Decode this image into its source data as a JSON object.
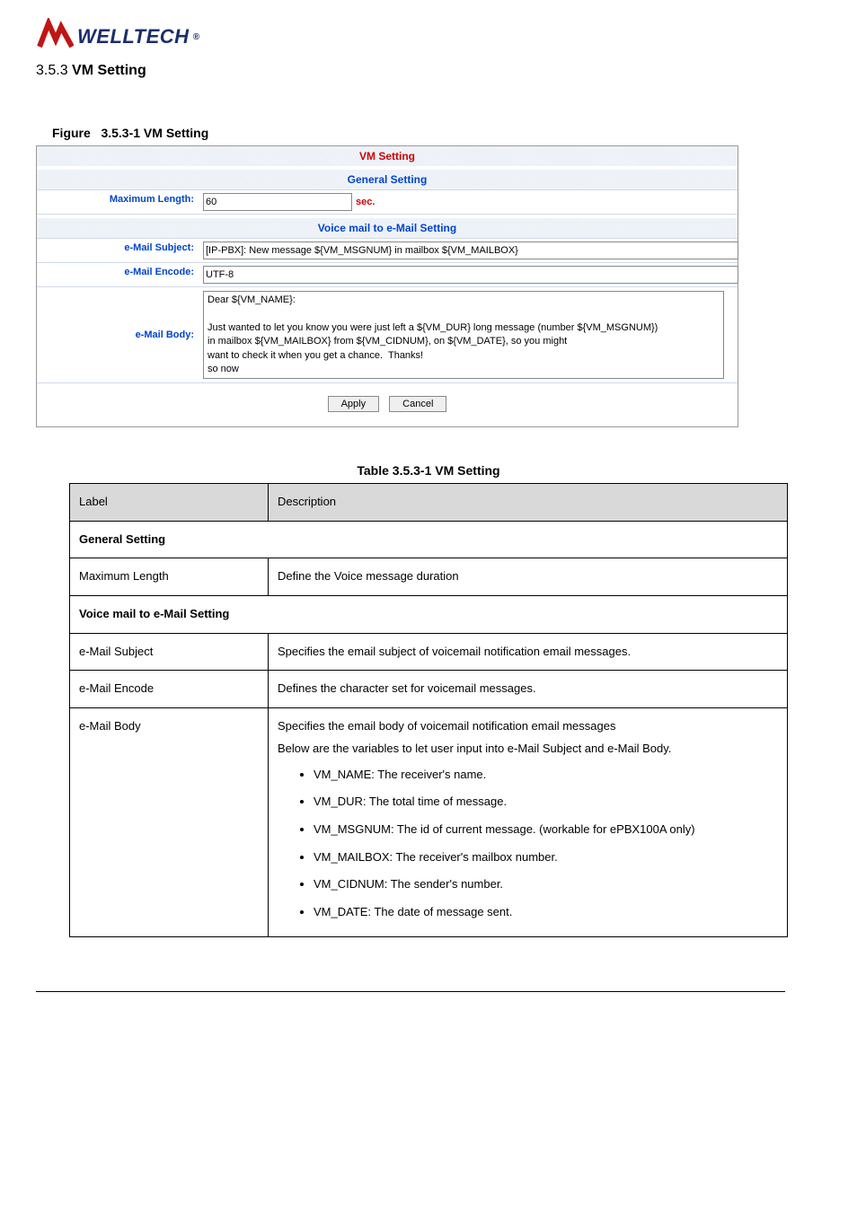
{
  "logo_text": "WELLTECH",
  "section_number": "3.5.3",
  "section_title": "VM Setting",
  "figure_caption_prefix": "Figure",
  "figure_caption": "3.5.3-1 VM Setting",
  "shot": {
    "title": "VM Setting",
    "general_heading": "General Setting",
    "max_length_label": "Maximum Length:",
    "max_length_value": "60",
    "sec_text": "sec.",
    "voice_heading": "Voice mail to e-Mail Setting",
    "subject_label": "e-Mail Subject:",
    "subject_value": "[IP-PBX]: New message ${VM_MSGNUM} in mailbox ${VM_MAILBOX}",
    "encode_label": "e-Mail Encode:",
    "encode_value": "UTF-8",
    "body_label": "e-Mail Body:",
    "body_value": "Dear ${VM_NAME}:\n\nJust wanted to let you know you were just left a ${VM_DUR} long message (number ${VM_MSGNUM})\nin mailbox ${VM_MAILBOX} from ${VM_CIDNUM}, on ${VM_DATE}, so you might\nwant to check it when you get a chance.  Thanks!\nso now",
    "apply": "Apply",
    "cancel": "Cancel"
  },
  "table_caption": "Table 3.5.3-1 VM Setting",
  "th_label": "Label",
  "th_desc": "Description",
  "row_general": "General Setting",
  "row_maxlen_l": "Maximum Length",
  "row_maxlen_d": "Define the Voice message duration",
  "row_voice": "Voice mail to e-Mail Setting",
  "row_subj_l": "e-Mail Subject",
  "row_subj_d1": "Specifies the email subject of voicemail notification email messages.",
  "row_enc_l": "e-Mail Encode",
  "row_enc_d": "Defines the character set for voicemail messages.",
  "row_body_l": "e-Mail Body",
  "row_body_d1": "Specifies the email body of voicemail notification email messages",
  "row_body_d2": "Below are the variables to let user input into e-Mail Subject and e-Mail Body.",
  "bullets": {
    "b1": "VM_NAME: The receiver's name.",
    "b2": "VM_DUR: The total time of message.",
    "b3": "VM_MSGNUM: The id of current message. (workable for ePBX100A only)",
    "b4": "VM_MAILBOX: The receiver's mailbox number.",
    "b5": "VM_CIDNUM: The sender's number.",
    "b6": "VM_DATE: The date of message sent."
  }
}
